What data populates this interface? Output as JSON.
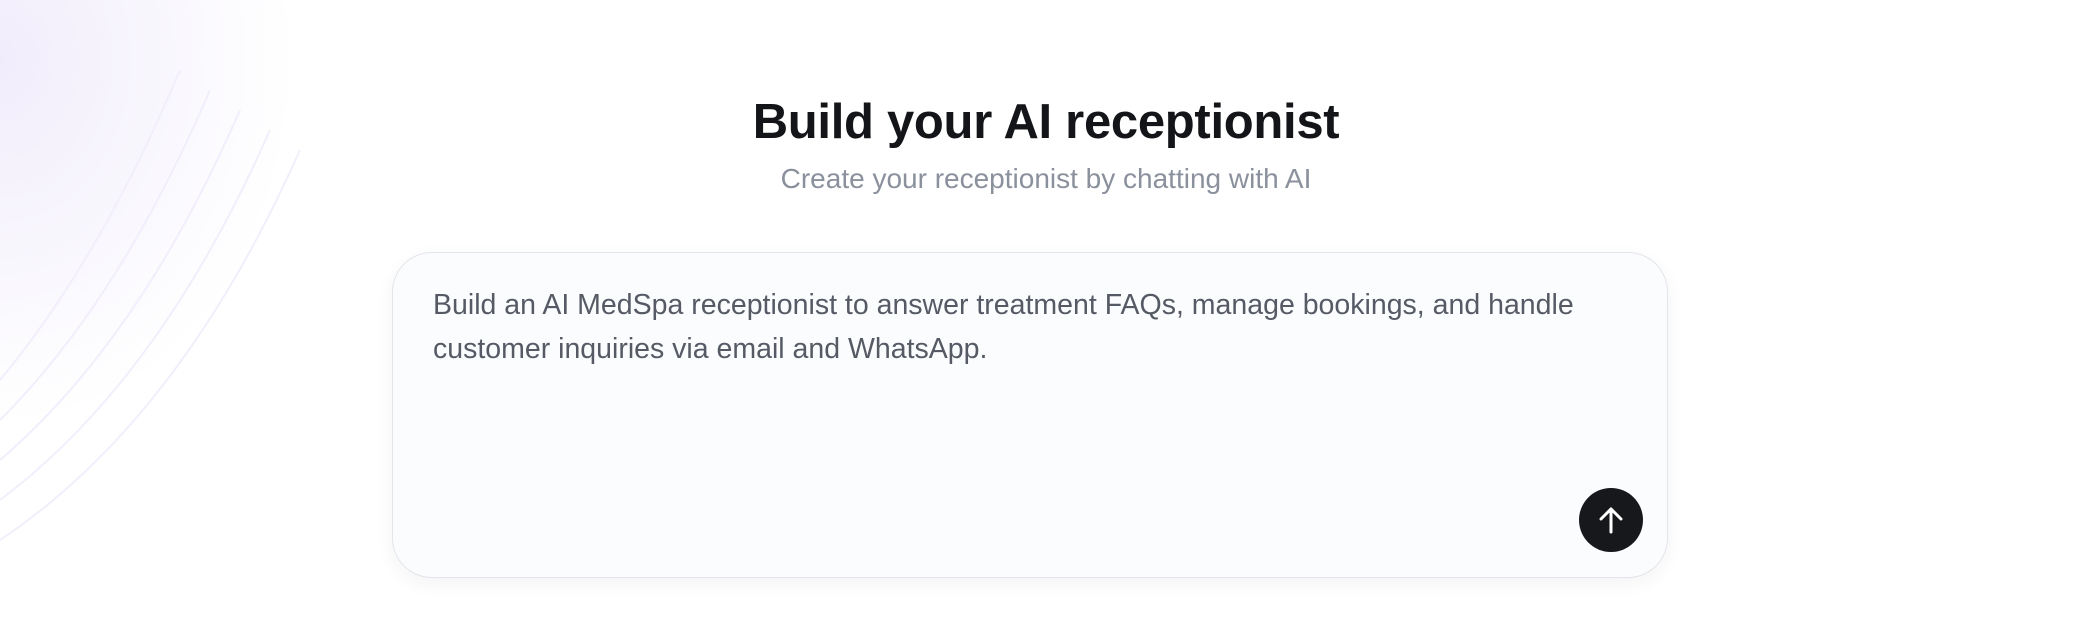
{
  "header": {
    "title": "Build your AI receptionist",
    "subtitle": "Create your receptionist by chatting with AI"
  },
  "composer": {
    "value": "Build an AI MedSpa receptionist to answer treatment FAQs, manage bookings, and handle customer inquiries via email and WhatsApp.",
    "send_icon": "arrow-up-icon"
  },
  "colors": {
    "title": "#141518",
    "subtitle": "#8a909c",
    "composer_text": "#555a64",
    "composer_background": "#fbfcfe",
    "send_button": "#16181b",
    "background_tint": "#ece6fa"
  }
}
